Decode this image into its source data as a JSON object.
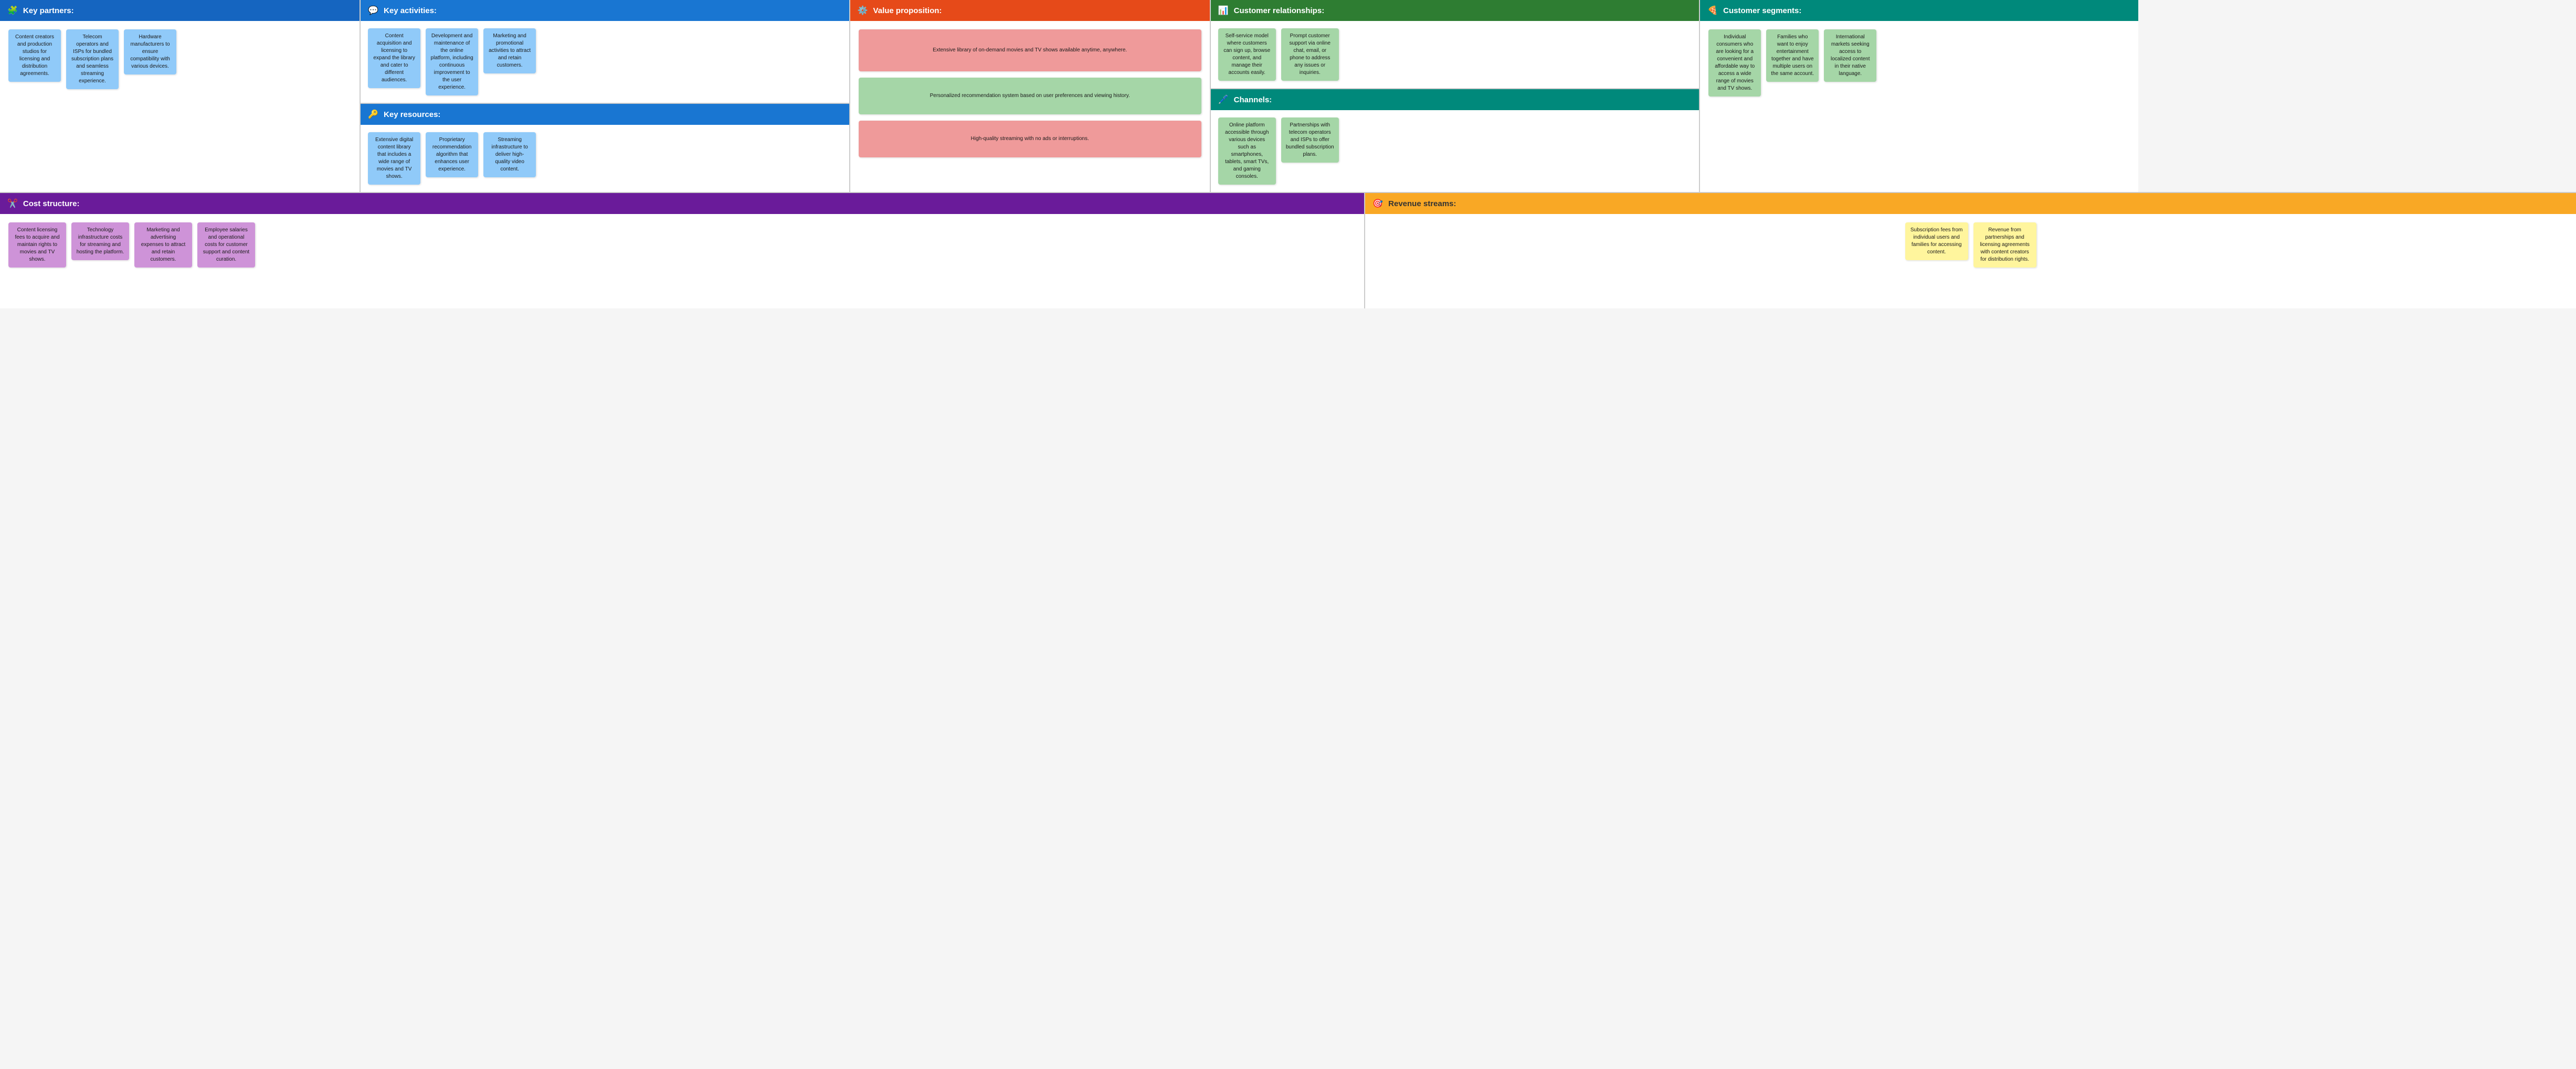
{
  "sections": {
    "key_partners": {
      "title": "Key partners:",
      "icon": "🧩",
      "cards": [
        {
          "text": "Content creators and production studios for licensing and distribution agreements.",
          "color": "card-blue"
        },
        {
          "text": "Telecom operators and ISPs for bundled subscription plans and seamless streaming experience.",
          "color": "card-blue"
        },
        {
          "text": "Hardware manufacturers to ensure compatibility with various devices.",
          "color": "card-blue"
        }
      ]
    },
    "key_activities": {
      "title": "Key activities:",
      "icon": "💬",
      "cards_top": [
        {
          "text": "Content acquisition and licensing to expand the library and cater to different audiences.",
          "color": "card-blue"
        },
        {
          "text": "Development and maintenance of the online platform, including continuous improvement to the user experience.",
          "color": "card-blue"
        },
        {
          "text": "Marketing and promotional activities to attract and retain customers.",
          "color": "card-blue"
        }
      ],
      "resources_title": "Key resources:",
      "resources_icon": "🔑",
      "cards_bottom": [
        {
          "text": "Extensive digital content library that includes a wide range of movies and TV shows.",
          "color": "card-blue"
        },
        {
          "text": "Proprietary recommendation algorithm that enhances user experience.",
          "color": "card-blue"
        },
        {
          "text": "Streaming infrastructure to deliver high-quality video content.",
          "color": "card-blue"
        }
      ]
    },
    "value_proposition": {
      "title": "Value proposition:",
      "icon": "⚙️",
      "cards": [
        {
          "text": "Extensive library of on-demand movies and TV shows available anytime, anywhere.",
          "color": "card-pink"
        },
        {
          "text": "Personalized recommendation system based on user preferences and viewing history.",
          "color": "card-green"
        },
        {
          "text": "High-quality streaming with no ads or interruptions.",
          "color": "card-pink"
        }
      ]
    },
    "customer_relationships": {
      "title": "Customer relationships:",
      "icon": "📊",
      "cards_top": [
        {
          "text": "Self-service model where customers can sign up, browse content, and manage their accounts easily.",
          "color": "card-green"
        },
        {
          "text": "Prompt customer support via online chat, email, or phone to address any issues or inquiries.",
          "color": "card-green"
        }
      ],
      "channels_title": "Channels:",
      "channels_icon": "🖊️",
      "cards_bottom": [
        {
          "text": "Online platform accessible through various devices such as smartphones, tablets, smart TVs, and gaming consoles.",
          "color": "card-green"
        },
        {
          "text": "Partnerships with telecom operators and ISPs to offer bundled subscription plans.",
          "color": "card-green"
        }
      ]
    },
    "customer_segments": {
      "title": "Customer segments:",
      "icon": "🍕",
      "cards": [
        {
          "text": "Individual consumers who are looking for a convenient and affordable way to access a wide range of movies and TV shows.",
          "color": "card-green"
        },
        {
          "text": "Families who want to enjoy entertainment together and have multiple users on the same account.",
          "color": "card-green"
        },
        {
          "text": "International markets seeking access to localized content in their native language.",
          "color": "card-green"
        }
      ]
    },
    "cost_structure": {
      "title": "Cost structure:",
      "icon": "✂️",
      "cards": [
        {
          "text": "Content licensing fees to acquire and maintain rights to movies and TV shows.",
          "color": "card-purple"
        },
        {
          "text": "Technology infrastructure costs for streaming and hosting the platform.",
          "color": "card-purple"
        },
        {
          "text": "Marketing and advertising expenses to attract and retain customers.",
          "color": "card-purple"
        },
        {
          "text": "Employee salaries and operational costs for customer support and content curation.",
          "color": "card-purple"
        }
      ]
    },
    "revenue_streams": {
      "title": "Revenue streams:",
      "icon": "🎯",
      "cards": [
        {
          "text": "Subscription fees from individual users and families for accessing content.",
          "color": "card-yellow"
        },
        {
          "text": "Revenue from partnerships and licensing agreements with content creators for distribution rights.",
          "color": "card-yellow"
        }
      ]
    }
  }
}
